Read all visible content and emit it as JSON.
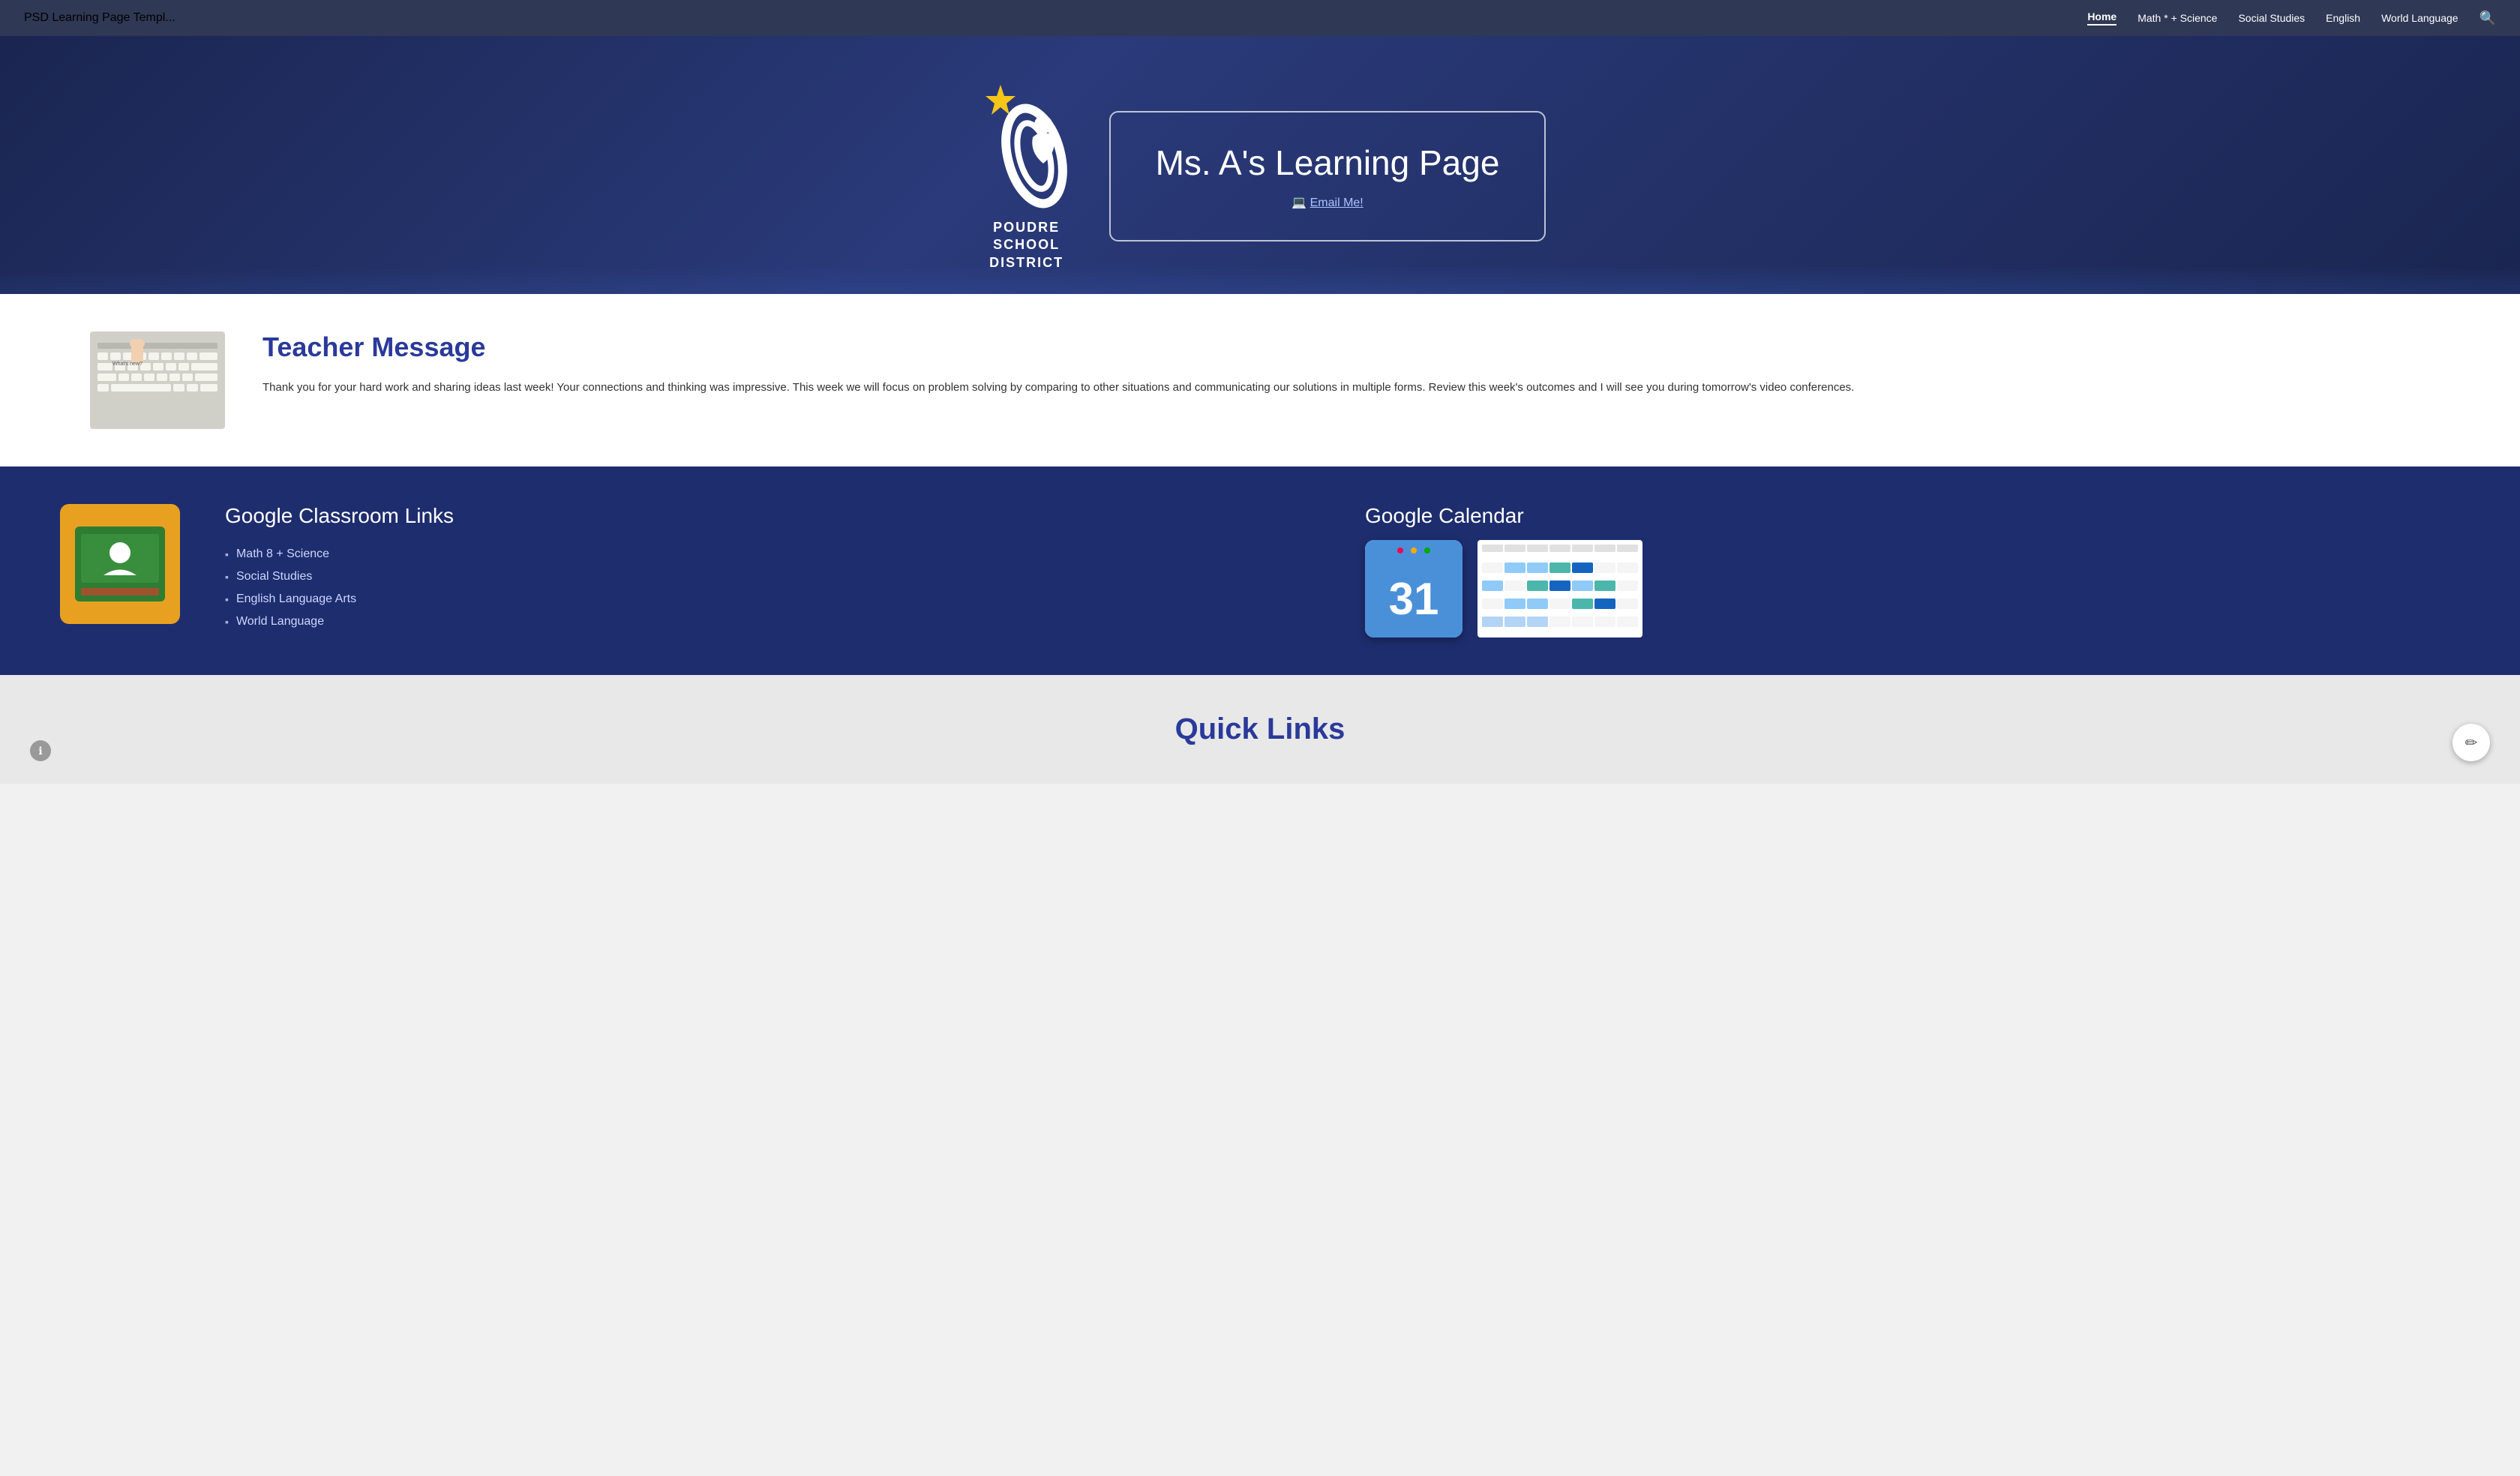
{
  "nav": {
    "brand": "PSD Learning Page Templ...",
    "links": [
      {
        "label": "Home",
        "active": true
      },
      {
        "label": "Math * + Science",
        "active": false
      },
      {
        "label": "Social Studies",
        "active": false
      },
      {
        "label": "English",
        "active": false
      },
      {
        "label": "World Language",
        "active": false
      }
    ],
    "search_icon": "🔍"
  },
  "hero": {
    "logo": {
      "line1": "POUDRE",
      "line2": "SCHOOL",
      "line3": "DISTRICT"
    },
    "title": "Ms. A's Learning Page",
    "email_label": "Email Me!",
    "email_icon": "💻"
  },
  "teacher_message": {
    "heading": "Teacher Message",
    "body": "Thank you for your hard work and sharing ideas last week!  Your connections and thinking was impressive.  This week we will focus on problem solving by comparing to other situations and communicating our solutions in multiple forms.  Review this week's outcomes and I will see you during tomorrow's video conferences."
  },
  "classroom": {
    "heading": "Google Classroom Links",
    "links": [
      {
        "label": "Math 8 + Science"
      },
      {
        "label": "Social Studies"
      },
      {
        "label": "English Language Arts"
      },
      {
        "label": "World Language"
      }
    ]
  },
  "calendar": {
    "heading": "Google Calendar",
    "day": "31"
  },
  "quick_links": {
    "heading": "Quick Links"
  },
  "icons": {
    "edit": "✏",
    "info": "ℹ"
  }
}
